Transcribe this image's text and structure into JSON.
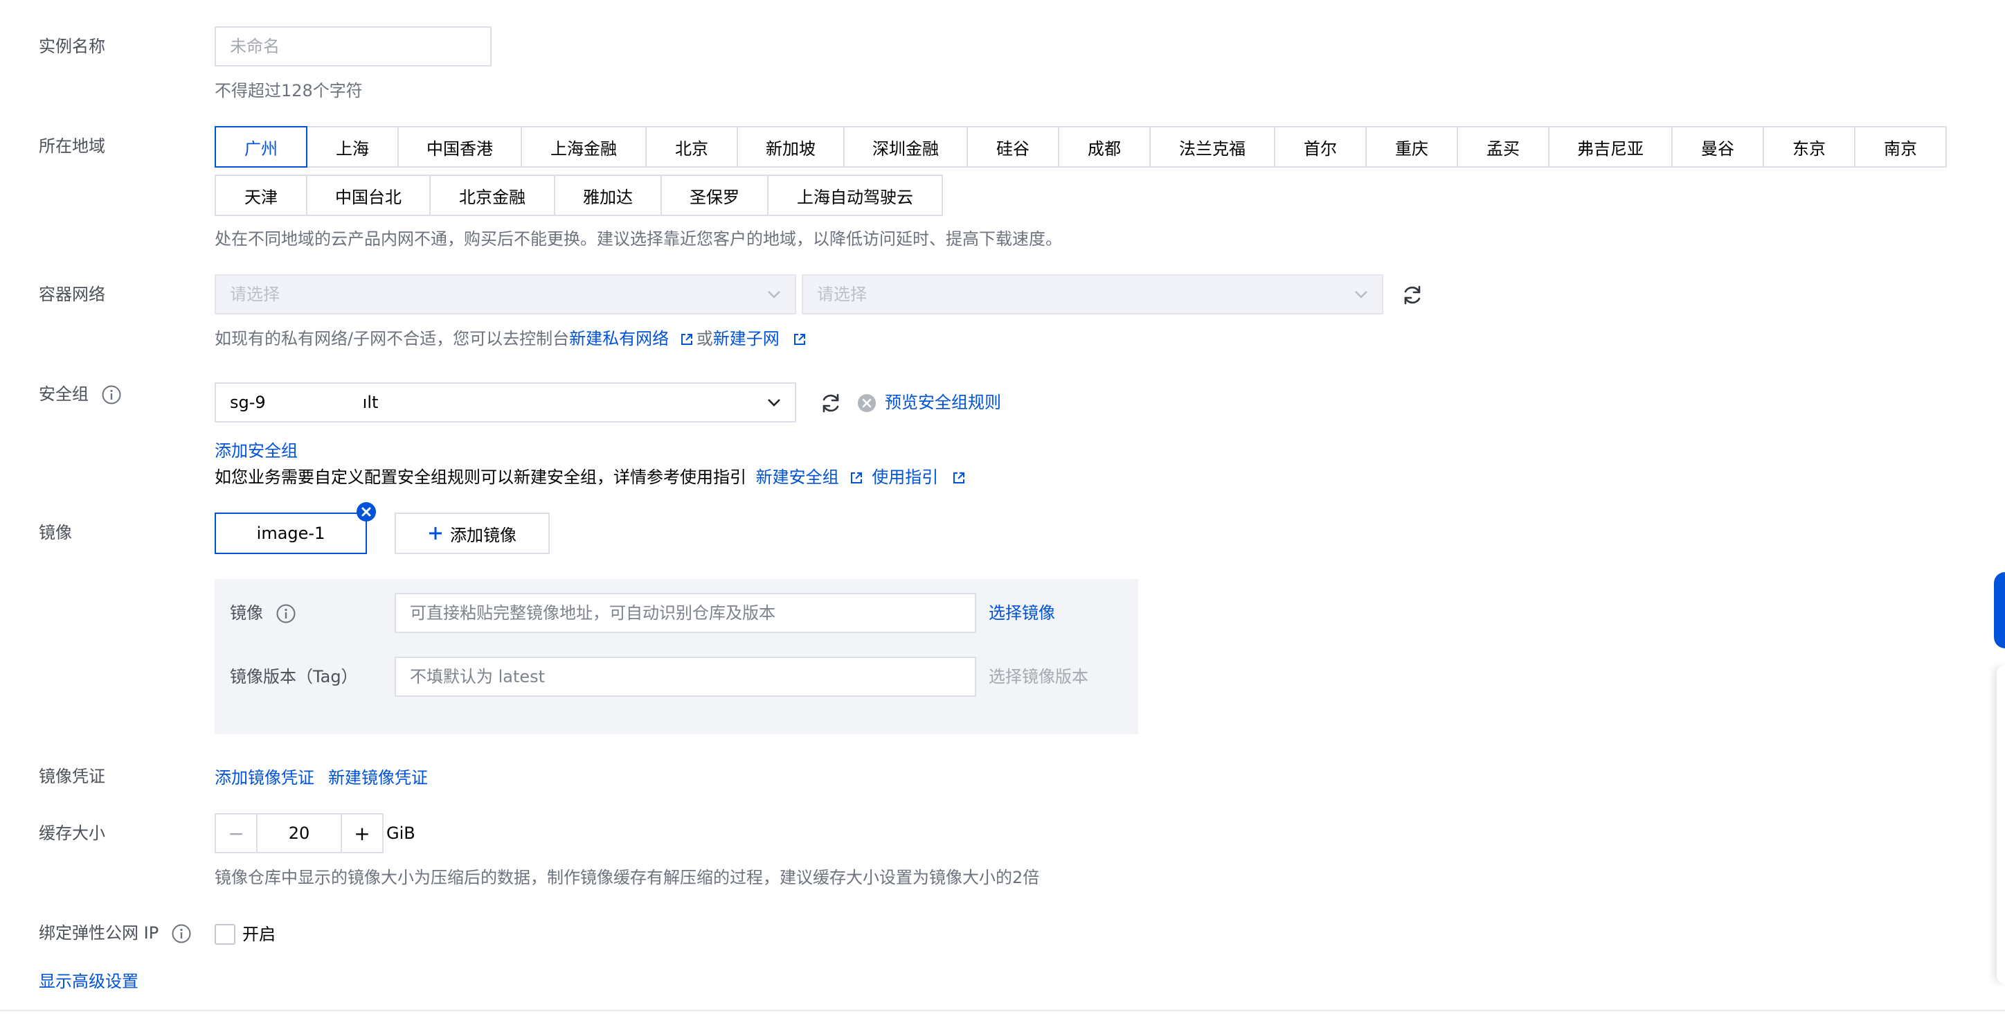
{
  "instance_name": {
    "label": "实例名称",
    "placeholder": "未命名",
    "help": "不得超过128个字符"
  },
  "region": {
    "label": "所在地域",
    "row1": [
      "广州",
      "上海",
      "中国香港",
      "上海金融",
      "北京",
      "新加坡",
      "深圳金融",
      "硅谷",
      "成都",
      "法兰克福",
      "首尔",
      "重庆",
      "孟买",
      "弗吉尼亚",
      "曼谷",
      "东京",
      "南京"
    ],
    "row2": [
      "天津",
      "中国台北",
      "北京金融",
      "雅加达",
      "圣保罗",
      "上海自动驾驶云"
    ],
    "selected": "广州",
    "help": "处在不同地域的云产品内网不通，购买后不能更换。建议选择靠近您客户的地域，以降低访问延时、提高下载速度。"
  },
  "network": {
    "label": "容器网络",
    "vpc_placeholder": "请选择",
    "subnet_placeholder": "请选择",
    "help_prefix": "如现有的私有网络/子网不合适，您可以去控制台",
    "new_vpc_link": "新建私有网络",
    "or_text": "或",
    "new_subnet_link": "新建子网"
  },
  "security_group": {
    "label": "安全组",
    "selected_prefix": "sg-9",
    "selected_suffix": "ılt",
    "preview_link": "预览安全组规则",
    "add_link": "添加安全组",
    "help_text": "如您业务需要自定义配置安全组规则可以新建安全组，详情参考使用指引",
    "new_sg_link": "新建安全组",
    "guide_link": "使用指引"
  },
  "image": {
    "label": "镜像",
    "tab_name": "image-1",
    "add_button": "添加镜像",
    "field_label": "镜像",
    "field_placeholder": "可直接粘贴完整镜像地址，可自动识别仓库及版本",
    "select_link": "选择镜像",
    "tag_label": "镜像版本（Tag）",
    "tag_placeholder": "不填默认为 latest",
    "select_tag_link": "选择镜像版本"
  },
  "credential": {
    "label": "镜像凭证",
    "add_link": "添加镜像凭证",
    "new_link": "新建镜像凭证"
  },
  "cache": {
    "label": "缓存大小",
    "value": "20",
    "unit": "GiB",
    "minus": "−",
    "plus": "+",
    "help": "镜像仓库中显示的镜像大小为压缩后的数据，制作镜像缓存有解压缩的过程，建议缓存大小设置为镜像大小的2倍"
  },
  "eip": {
    "label": "绑定弹性公网 IP",
    "checkbox_label": "开启"
  },
  "advanced_link": "显示高级设置",
  "colors": {
    "primary": "#0052d9",
    "label": "#4b5159",
    "help": "#6c737d",
    "border": "#dcdfe5",
    "placeholder": "#a4a9b1"
  }
}
